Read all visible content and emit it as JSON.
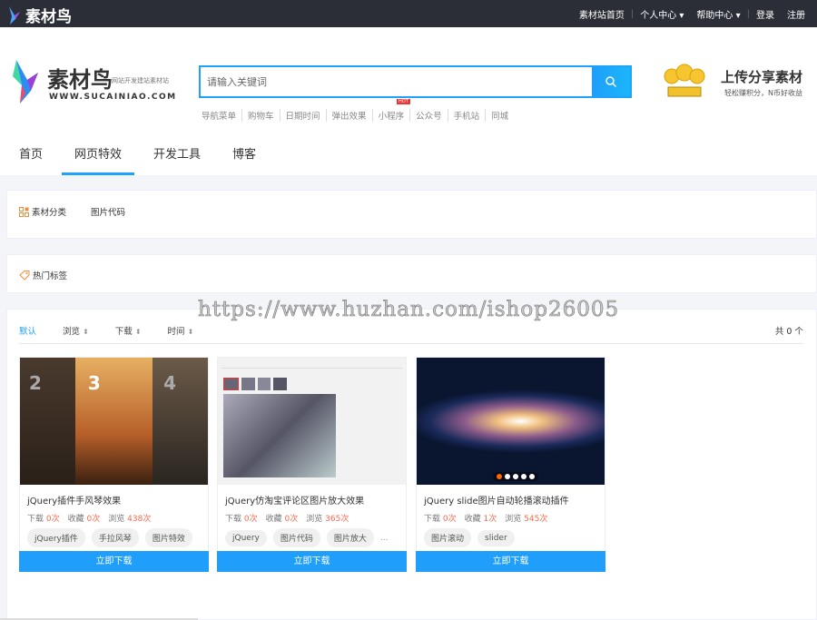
{
  "topbar": {
    "logo": "素材鸟",
    "links": [
      "素材站首页",
      "个人中心",
      "帮助中心",
      "登录",
      "注册"
    ]
  },
  "header": {
    "logo_name": "素材鸟",
    "logo_slogan": "网站开发建站素材站",
    "logo_url": "WWW.SUCAINIAO.COM",
    "search_placeholder": "请输入关键词",
    "hot_words": [
      "导航菜单",
      "购物车",
      "日期时间",
      "弹出效果",
      "小程序",
      "公众号",
      "手机站",
      "同城"
    ],
    "hot_badge": "HOT",
    "upload_title": "上传分享素材",
    "upload_sub": "轻松赚积分，N币好收益"
  },
  "nav": [
    "首页",
    "网页特效",
    "开发工具",
    "博客"
  ],
  "filters": {
    "category_label": "素材分类",
    "category_item": "图片代码",
    "tags_label": "热门标签"
  },
  "sort": {
    "items": [
      "默认",
      "浏览",
      "下载",
      "时间"
    ],
    "total": "共 0 个"
  },
  "watermark": "https://www.huzhan.com/ishop26005",
  "cards": [
    {
      "title": "jQuery插件手风琴效果",
      "dl_label": "下载",
      "dl": "0次",
      "fav_label": "收藏",
      "fav": "0次",
      "view_label": "浏览",
      "view": "438次",
      "tags": [
        "jQuery插件",
        "手拉风琴",
        "图片特效"
      ],
      "more": "",
      "button": "立即下载",
      "thumb_nums": [
        "2",
        "3",
        "4"
      ]
    },
    {
      "title": "jQuery仿淘宝评论区图片放大效果",
      "dl_label": "下载",
      "dl": "0次",
      "fav_label": "收藏",
      "fav": "0次",
      "view_label": "浏览",
      "view": "365次",
      "tags": [
        "jQuery",
        "图片代码",
        "图片放大"
      ],
      "more": "...",
      "button": "立即下载",
      "thumb_nums": [
        "",
        "",
        ""
      ]
    },
    {
      "title": "jQuery slide图片自动轮播滚动插件",
      "dl_label": "下载",
      "dl": "0次",
      "fav_label": "收藏",
      "fav": "1次",
      "view_label": "浏览",
      "view": "545次",
      "tags": [
        "图片滚动",
        "slider"
      ],
      "more": "",
      "button": "立即下载",
      "thumb_nums": [
        "",
        "",
        ""
      ]
    }
  ]
}
